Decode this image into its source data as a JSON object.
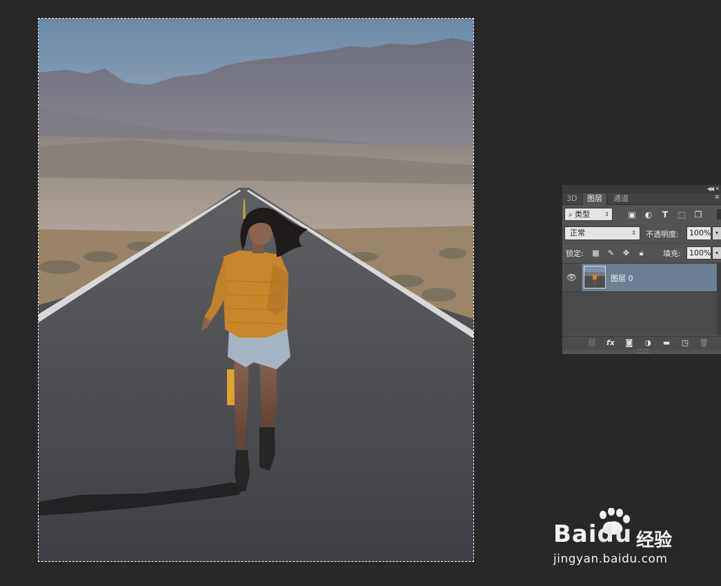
{
  "document": {
    "image_name": "running-woman-desert-road-photo",
    "selection": "marquee-all"
  },
  "layers_panel": {
    "tabs": [
      {
        "label": "3D",
        "active": false
      },
      {
        "label": "图层",
        "active": true
      },
      {
        "label": "通道",
        "active": false
      }
    ],
    "filter": {
      "value": "类型",
      "icons": [
        "image-filter-icon",
        "adjustment-filter-icon",
        "type-filter-icon",
        "shape-filter-icon",
        "smart-object-filter-icon"
      ]
    },
    "blend_mode": {
      "value": "正常"
    },
    "opacity": {
      "label": "不透明度:",
      "value": "100%"
    },
    "lock": {
      "label": "锁定:",
      "icons": [
        "lock-transparent-icon",
        "lock-paint-icon",
        "lock-position-icon",
        "lock-all-icon"
      ]
    },
    "fill": {
      "label": "填充:",
      "value": "100%"
    },
    "layers": [
      {
        "name": "图层 0",
        "visible": true,
        "selected": true
      }
    ],
    "bottom_icons": [
      "link-layers-icon",
      "fx-icon",
      "add-mask-icon",
      "adjustment-layer-icon",
      "new-group-icon",
      "new-layer-icon",
      "delete-layer-icon"
    ],
    "fx_label": "fx"
  },
  "colors": {
    "workspace": "#282828",
    "panel": "#535353",
    "selected_layer": "#6e7e93",
    "sweater": "#c9862b",
    "road": "#4a4c51",
    "sky": "#6e8aa6"
  },
  "watermark": {
    "brand_left": "Bai",
    "brand_right": "du",
    "brand_cn": "经验",
    "url": "jingyan.baidu.com"
  }
}
